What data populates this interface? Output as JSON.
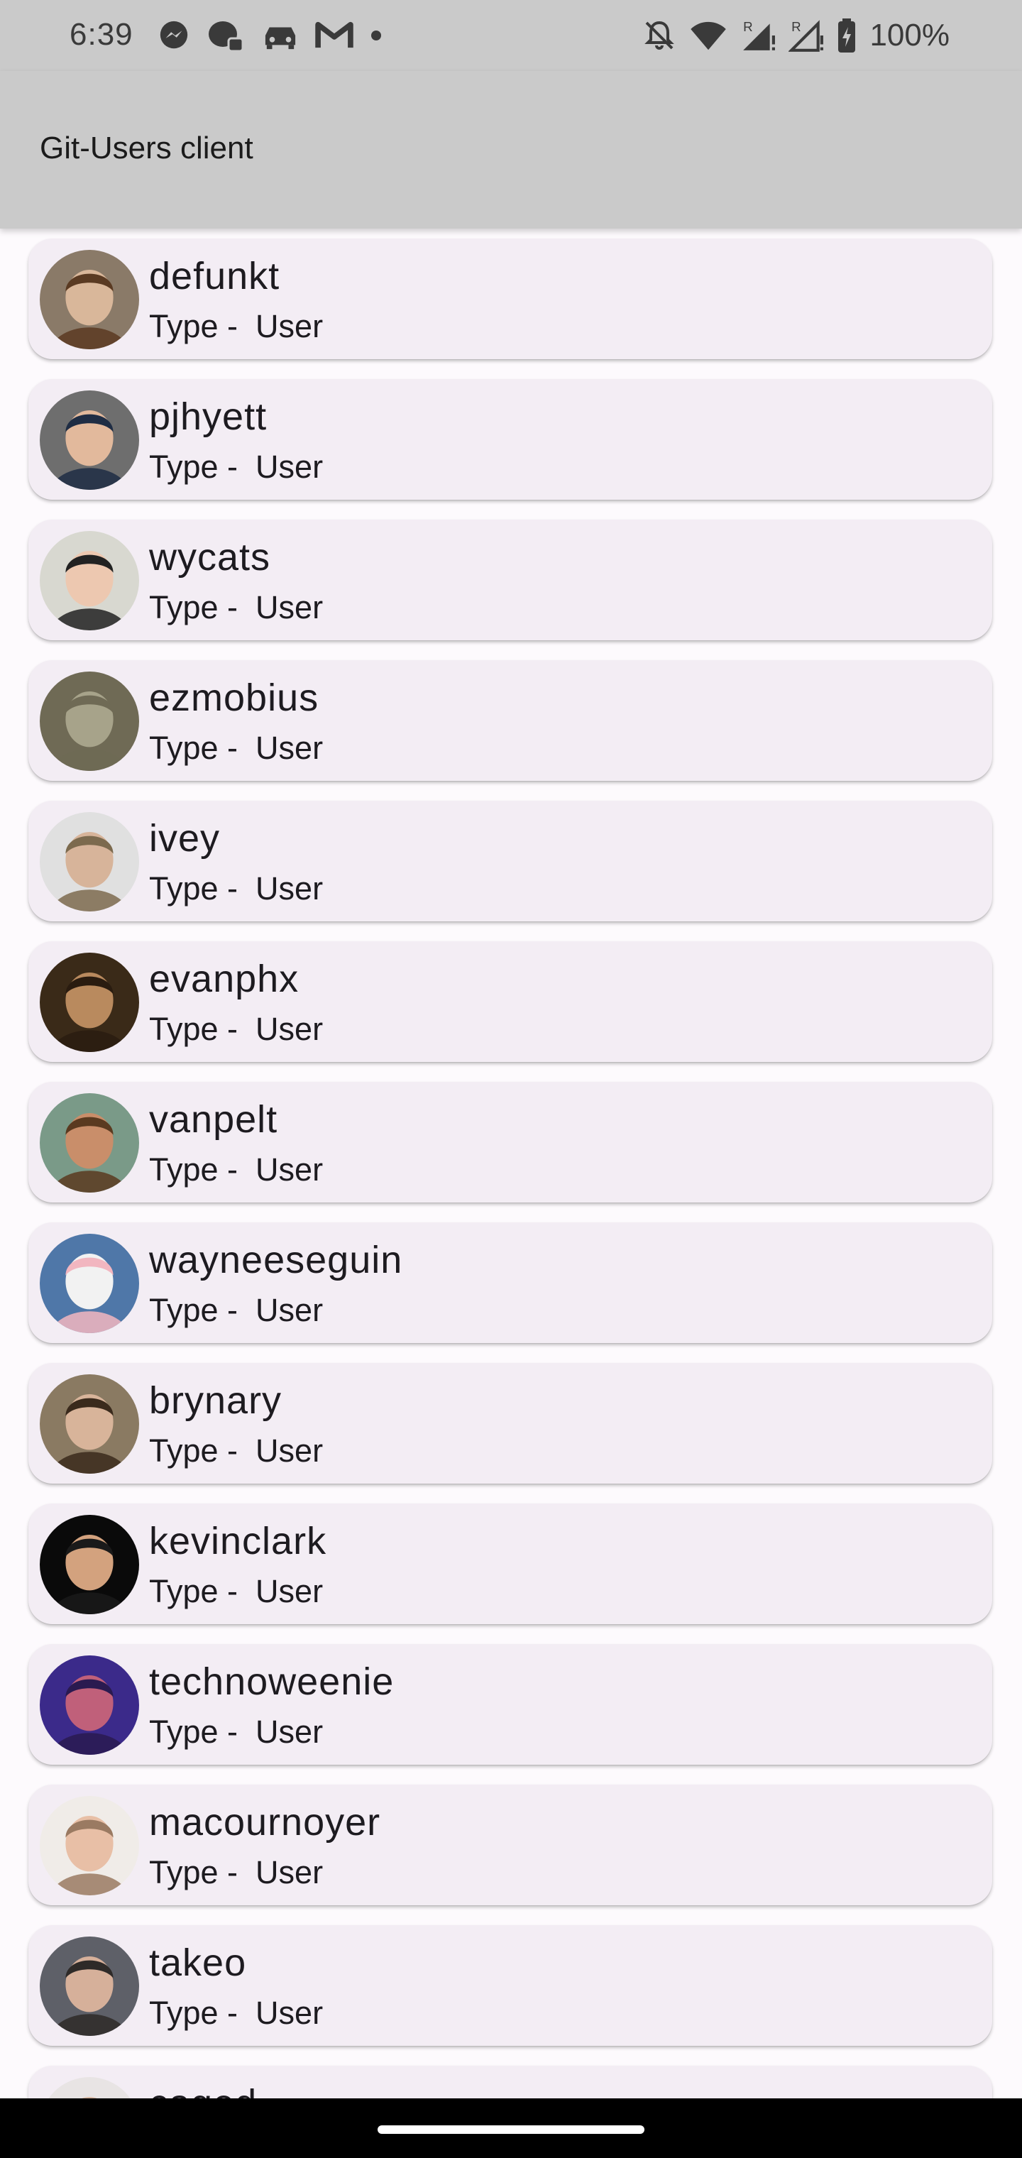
{
  "status_bar": {
    "time": "6:39",
    "battery": "100%",
    "left_icons": [
      "messenger-icon",
      "chat-bubble-icon",
      "car-icon",
      "gmail-icon",
      "dot-icon"
    ],
    "right_icons": [
      "bell-off-icon",
      "wifi-icon",
      "signal-roaming-icon",
      "signal-roaming-icon",
      "battery-charging-icon"
    ]
  },
  "app_bar": {
    "title": "Git-Users client"
  },
  "users": [
    {
      "login": "defunkt",
      "type_label": "Type -  User",
      "avatar": {
        "bg": "#8a7a68",
        "skin": "#d9b79a",
        "hair": "#5a3a22"
      }
    },
    {
      "login": "pjhyett",
      "type_label": "Type -  User",
      "avatar": {
        "bg": "#6e6e6e",
        "skin": "#e2b99c",
        "hair": "#1f2d44"
      }
    },
    {
      "login": "wycats",
      "type_label": "Type -  User",
      "avatar": {
        "bg": "#d8d8d0",
        "skin": "#edc8b0",
        "hair": "#222222"
      }
    },
    {
      "login": "ezmobius",
      "type_label": "Type -  User",
      "avatar": {
        "bg": "#6f6a55",
        "skin": "#a7a38a",
        "hair": "#6f6a55"
      }
    },
    {
      "login": "ivey",
      "type_label": "Type -  User",
      "avatar": {
        "bg": "#e0e0e0",
        "skin": "#d7b49a",
        "hair": "#7c6a4e"
      }
    },
    {
      "login": "evanphx",
      "type_label": "Type -  User",
      "avatar": {
        "bg": "#3a2a18",
        "skin": "#b98a5e",
        "hair": "#2a1c10"
      }
    },
    {
      "login": "vanpelt",
      "type_label": "Type -  User",
      "avatar": {
        "bg": "#7a9a88",
        "skin": "#c98e6a",
        "hair": "#5a3a20"
      }
    },
    {
      "login": "wayneeseguin",
      "type_label": "Type -  User",
      "avatar": {
        "bg": "#4f77a8",
        "skin": "#f2f2f2",
        "hair": "#f2b6c0"
      }
    },
    {
      "login": "brynary",
      "type_label": "Type -  User",
      "avatar": {
        "bg": "#8a7a62",
        "skin": "#d8b49a",
        "hair": "#3a2a1c"
      }
    },
    {
      "login": "kevinclark",
      "type_label": "Type -  User",
      "avatar": {
        "bg": "#0a0a0a",
        "skin": "#d3a27e",
        "hair": "#1a1a1a"
      }
    },
    {
      "login": "technoweenie",
      "type_label": "Type -  User",
      "avatar": {
        "bg": "#3b2a8a",
        "skin": "#c0607a",
        "hair": "#2a1a50"
      }
    },
    {
      "login": "macournoyer",
      "type_label": "Type -  User",
      "avatar": {
        "bg": "#f0ece8",
        "skin": "#e8bfa6",
        "hair": "#9a7a62"
      }
    },
    {
      "login": "takeo",
      "type_label": "Type -  User",
      "avatar": {
        "bg": "#5e6068",
        "skin": "#d6b09a",
        "hair": "#2e2a28"
      }
    },
    {
      "login": "caged",
      "type_label": "",
      "avatar": {
        "bg": "#e8e4e4",
        "skin": "#d9b8a2",
        "hair": "#4a3a30"
      }
    }
  ]
}
